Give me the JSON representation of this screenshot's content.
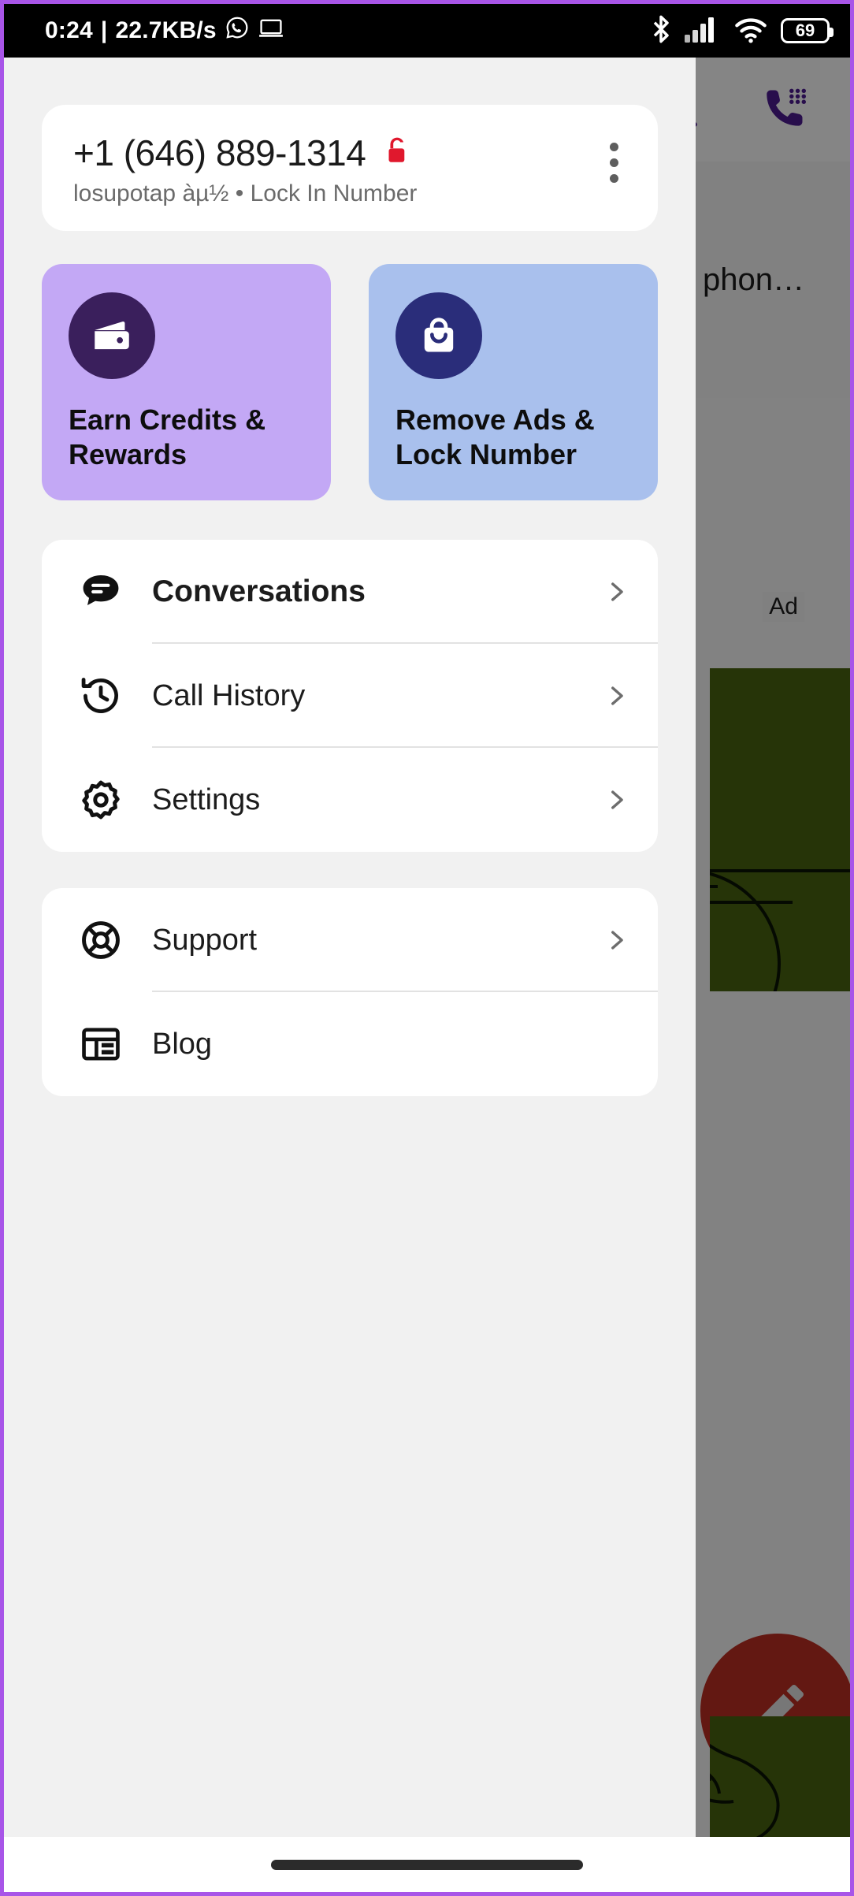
{
  "statusbar": {
    "time": "0:24",
    "separator": "|",
    "network_speed": "22.7KB/s",
    "whatsapp_icon": "whatsapp-icon",
    "cast_icon": "screencast-icon",
    "bluetooth_icon": "bluetooth-icon",
    "signal_icon": "cellular-signal-icon",
    "wifi_icon": "wifi-icon",
    "battery_level": "69"
  },
  "drawer": {
    "number_card": {
      "phone_number": "+1 (646) 889-1314",
      "lock_icon": "unlocked-padlock-icon",
      "lock_color": "#e0182d",
      "subtitle": "losupotap àµ½ • Lock In Number",
      "overflow_icon": "more-vertical-icon"
    },
    "promos": [
      {
        "id": "earn-credits",
        "title": "Earn Credits & Rewards",
        "icon": "wallet-icon",
        "bg": "#c3a8f5",
        "circle": "#3a1f5c"
      },
      {
        "id": "remove-ads",
        "title": "Remove Ads & Lock Number",
        "icon": "shopping-bag-icon",
        "bg": "#a9c0ed",
        "circle": "#2a2d7a"
      }
    ],
    "menu_groups": [
      {
        "id": "primary",
        "items": [
          {
            "label": "Conversations",
            "icon": "chat-bubble-icon",
            "bold": true,
            "chevron": true
          },
          {
            "label": "Call History",
            "icon": "history-clock-icon",
            "bold": false,
            "chevron": true
          },
          {
            "label": "Settings",
            "icon": "gear-icon",
            "bold": false,
            "chevron": true
          }
        ]
      },
      {
        "id": "secondary",
        "items": [
          {
            "label": "Support",
            "icon": "lifebuoy-icon",
            "bold": false,
            "chevron": true
          },
          {
            "label": "Blog",
            "icon": "blog-layout-icon",
            "bold": false,
            "chevron": false
          }
        ]
      }
    ]
  },
  "background_app": {
    "search_icon": "search-icon",
    "dialpad_call_icon": "dialpad-phone-icon",
    "accent_color": "#4b1a8c",
    "hero_text_partial": "ur phon…",
    "ad_label": "Ad",
    "ad_bg_color": "#47600f",
    "fab_icon": "pencil-edit-icon",
    "fab_color": "#b72d22"
  },
  "bottom_nav": {
    "gesture_pill": "home-gesture-pill"
  }
}
